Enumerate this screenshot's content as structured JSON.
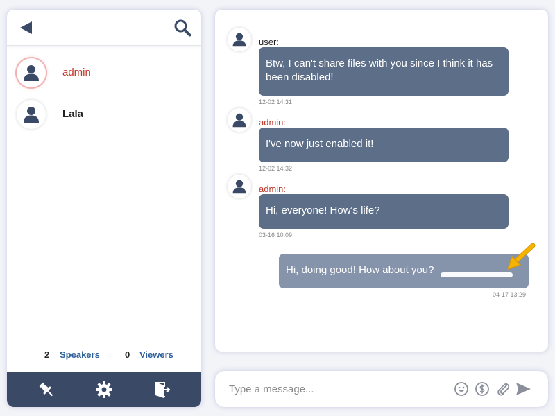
{
  "sidebar": {
    "icons": {
      "back": "back-arrow-icon",
      "search": "search-icon"
    },
    "users": [
      {
        "name": "admin",
        "active": true
      },
      {
        "name": "Lala",
        "active": false
      }
    ],
    "stats": {
      "speakers_count": "2",
      "speakers_label": "Speakers",
      "viewers_count": "0",
      "viewers_label": "Viewers"
    },
    "footer_icons": [
      "pin-icon",
      "gear-icon",
      "exit-door-icon"
    ]
  },
  "chat": {
    "messages": [
      {
        "sender": "user:",
        "text_line1": "Btw, I can't share files with you since I think it has",
        "text_line2": "been disabled!",
        "time": "12-02 14:31"
      },
      {
        "sender": "admin:",
        "text": "I've now just enabled it!",
        "time": "12-02 14:32"
      },
      {
        "sender": "admin:",
        "text": "Hi, everyone! How's life?",
        "time": "03-16 10:09"
      },
      {
        "sender": "",
        "text": "Hi, doing good! How about you?",
        "time": "04-17 13:29",
        "own": true
      }
    ]
  },
  "composer": {
    "placeholder": "Type a message...",
    "icons": [
      "emoji-icon",
      "dollar-icon",
      "paperclip-icon",
      "send-icon"
    ]
  },
  "colors": {
    "bubble": "#5c6e88",
    "own_bubble": "#8593ab",
    "footer": "#3a4a66",
    "admin_name": "#c0392b",
    "link": "#2d5f9a",
    "annotation_arrow": "#f0b100"
  }
}
